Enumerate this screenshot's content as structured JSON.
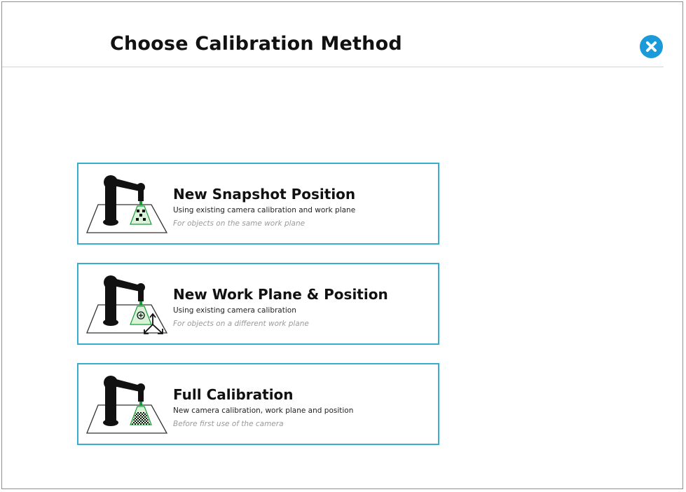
{
  "dialog": {
    "title": "Choose Calibration Method",
    "close_icon": "close-circle-icon",
    "accent_color": "#1a9ad8",
    "card_border_color": "#3aaccd"
  },
  "options": [
    {
      "title": "New Snapshot Position",
      "description": "Using existing camera calibration and work plane",
      "note": "For objects on the same work plane",
      "icon": "robot-snapshot-icon"
    },
    {
      "title": "New Work Plane & Position",
      "description": "Using existing camera calibration",
      "note": "For objects on a different work plane",
      "icon": "robot-work-plane-icon"
    },
    {
      "title": "Full Calibration",
      "description": "New camera calibration, work plane and position",
      "note": "Before first use of the camera",
      "icon": "robot-full-calibration-icon"
    }
  ]
}
